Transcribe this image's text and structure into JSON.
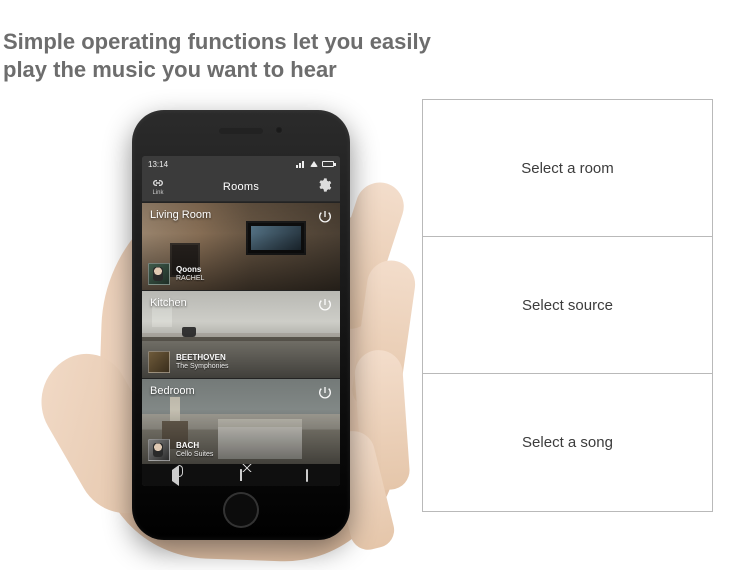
{
  "headline": {
    "line1": "Simple operating functions let you easily",
    "line2": "play the music you want to hear"
  },
  "phone": {
    "status": {
      "time": "13:14"
    },
    "appbar": {
      "title": "Rooms",
      "link_label": "Link"
    },
    "rooms": [
      {
        "name": "Living Room",
        "bg_class": "bg-living",
        "album_class": "album-rachel",
        "now_playing": {
          "artist": "Qoons",
          "title": "RACHEL"
        }
      },
      {
        "name": "Kitchen",
        "bg_class": "bg-kitchen",
        "album_class": "album-beeth",
        "now_playing": {
          "artist": "BEETHOVEN",
          "title": "The Symphonies"
        }
      },
      {
        "name": "Bedroom",
        "bg_class": "bg-bedroom",
        "album_class": "album-bach",
        "now_playing": {
          "artist": "BACH",
          "title": "Cello Suites"
        }
      }
    ]
  },
  "steps": [
    {
      "label": "Select a room"
    },
    {
      "label": "Select source"
    },
    {
      "label": "Select a song"
    }
  ]
}
